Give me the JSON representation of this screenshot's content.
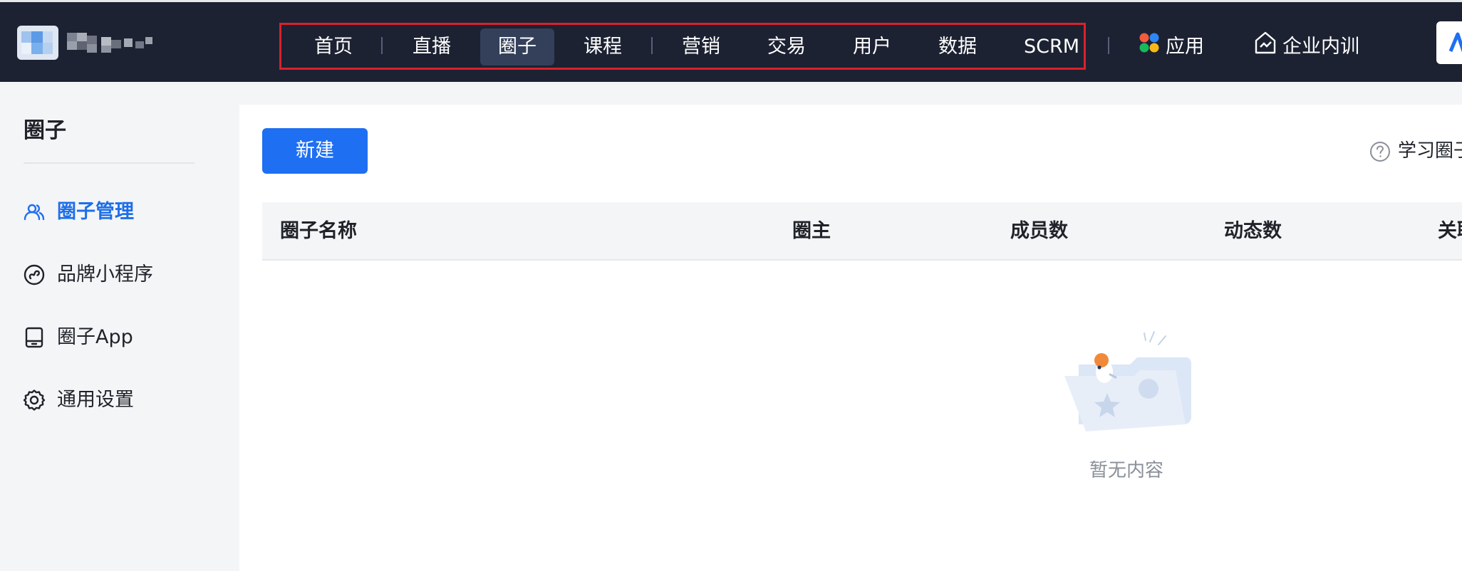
{
  "header": {
    "nav": [
      {
        "label": "首页"
      },
      {
        "label": "直播"
      },
      {
        "label": "圈子",
        "active": true
      },
      {
        "label": "课程"
      },
      {
        "label": "营销"
      },
      {
        "label": "交易"
      },
      {
        "label": "用户"
      },
      {
        "label": "数据"
      },
      {
        "label": "SCRM"
      }
    ],
    "apps_label": "应用",
    "training_label": "企业内训"
  },
  "sidebar": {
    "title": "圈子",
    "items": [
      {
        "label": "圈子管理",
        "icon": "users-icon",
        "active": true
      },
      {
        "label": "品牌小程序",
        "icon": "mini-program-icon"
      },
      {
        "label": "圈子App",
        "icon": "tablet-icon"
      },
      {
        "label": "通用设置",
        "icon": "gear-icon"
      }
    ]
  },
  "toolbar": {
    "new_label": "新建",
    "help_label": "学习圈子"
  },
  "table": {
    "columns": [
      "圈子名称",
      "圈主",
      "成员数",
      "动态数",
      "关联"
    ]
  },
  "empty": {
    "text": "暂无内容"
  },
  "colors": {
    "topbar_bg": "#1c2232",
    "accent": "#1e6ff1",
    "highlight_frame": "#d9212d",
    "active_nav_bg": "#34405a"
  }
}
